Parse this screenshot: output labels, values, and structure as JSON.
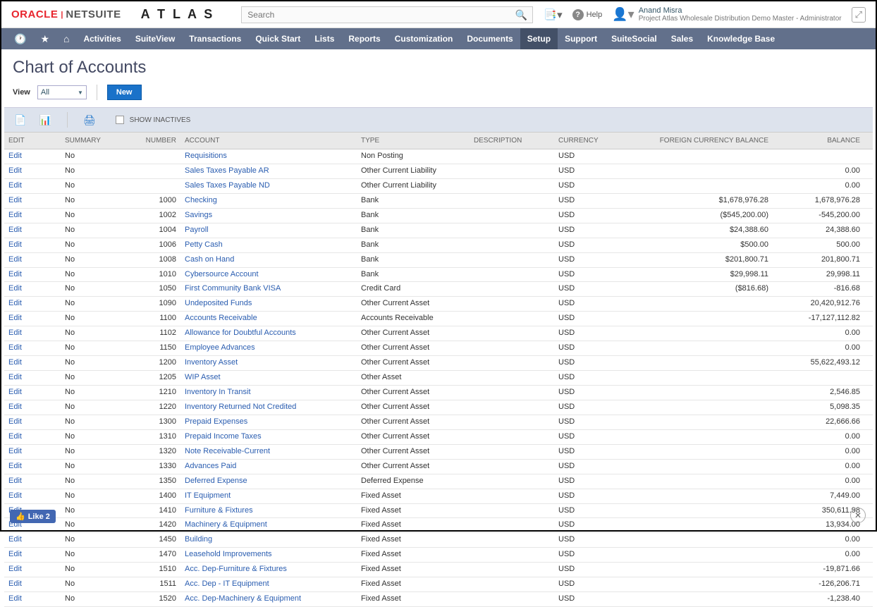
{
  "header": {
    "brand_oracle": "ORACLE",
    "brand_netsuite": "NETSUITE",
    "brand_atlas": "A T L A S",
    "search_placeholder": "Search",
    "help_label": "Help",
    "user_name": "Anand Misra",
    "user_role": "Project Atlas Wholesale Distribution Demo Master - Administrator"
  },
  "nav": {
    "items": [
      "Activities",
      "SuiteView",
      "Transactions",
      "Quick Start",
      "Lists",
      "Reports",
      "Customization",
      "Documents",
      "Setup",
      "Support",
      "SuiteSocial",
      "Sales",
      "Knowledge Base"
    ],
    "active_index": 8
  },
  "page": {
    "title": "Chart of Accounts",
    "view_label": "View",
    "view_value": "All",
    "new_button": "New",
    "show_inactives": "SHOW INACTIVES"
  },
  "columns": {
    "edit": "EDIT",
    "summary": "SUMMARY",
    "number": "NUMBER",
    "account": "ACCOUNT",
    "type": "TYPE",
    "description": "DESCRIPTION",
    "currency": "CURRENCY",
    "fcb": "FOREIGN CURRENCY BALANCE",
    "balance": "BALANCE"
  },
  "rows": [
    {
      "edit": "Edit",
      "summary": "No",
      "number": "",
      "account": "Requisitions",
      "type": "Non Posting",
      "desc": "",
      "currency": "USD",
      "fcb": "",
      "bal": ""
    },
    {
      "edit": "Edit",
      "summary": "No",
      "number": "",
      "account": "Sales Taxes Payable AR",
      "type": "Other Current Liability",
      "desc": "",
      "currency": "USD",
      "fcb": "",
      "bal": "0.00"
    },
    {
      "edit": "Edit",
      "summary": "No",
      "number": "",
      "account": "Sales Taxes Payable ND",
      "type": "Other Current Liability",
      "desc": "",
      "currency": "USD",
      "fcb": "",
      "bal": "0.00"
    },
    {
      "edit": "Edit",
      "summary": "No",
      "number": "1000",
      "account": "Checking",
      "type": "Bank",
      "desc": "",
      "currency": "USD",
      "fcb": "$1,678,976.28",
      "bal": "1,678,976.28"
    },
    {
      "edit": "Edit",
      "summary": "No",
      "number": "1002",
      "account": "Savings",
      "type": "Bank",
      "desc": "",
      "currency": "USD",
      "fcb": "($545,200.00)",
      "bal": "-545,200.00"
    },
    {
      "edit": "Edit",
      "summary": "No",
      "number": "1004",
      "account": "Payroll",
      "type": "Bank",
      "desc": "",
      "currency": "USD",
      "fcb": "$24,388.60",
      "bal": "24,388.60"
    },
    {
      "edit": "Edit",
      "summary": "No",
      "number": "1006",
      "account": "Petty Cash",
      "type": "Bank",
      "desc": "",
      "currency": "USD",
      "fcb": "$500.00",
      "bal": "500.00"
    },
    {
      "edit": "Edit",
      "summary": "No",
      "number": "1008",
      "account": "Cash on Hand",
      "type": "Bank",
      "desc": "",
      "currency": "USD",
      "fcb": "$201,800.71",
      "bal": "201,800.71"
    },
    {
      "edit": "Edit",
      "summary": "No",
      "number": "1010",
      "account": "Cybersource Account",
      "type": "Bank",
      "desc": "",
      "currency": "USD",
      "fcb": "$29,998.11",
      "bal": "29,998.11"
    },
    {
      "edit": "Edit",
      "summary": "No",
      "number": "1050",
      "account": "First Community Bank VISA",
      "type": "Credit Card",
      "desc": "",
      "currency": "USD",
      "fcb": "($816.68)",
      "bal": "-816.68"
    },
    {
      "edit": "Edit",
      "summary": "No",
      "number": "1090",
      "account": "Undeposited Funds",
      "type": "Other Current Asset",
      "desc": "",
      "currency": "USD",
      "fcb": "",
      "bal": "20,420,912.76"
    },
    {
      "edit": "Edit",
      "summary": "No",
      "number": "1100",
      "account": "Accounts Receivable",
      "type": "Accounts Receivable",
      "desc": "",
      "currency": "USD",
      "fcb": "",
      "bal": "-17,127,112.82"
    },
    {
      "edit": "Edit",
      "summary": "No",
      "number": "1102",
      "account": "Allowance for Doubtful Accounts",
      "type": "Other Current Asset",
      "desc": "",
      "currency": "USD",
      "fcb": "",
      "bal": "0.00"
    },
    {
      "edit": "Edit",
      "summary": "No",
      "number": "1150",
      "account": "Employee Advances",
      "type": "Other Current Asset",
      "desc": "",
      "currency": "USD",
      "fcb": "",
      "bal": "0.00"
    },
    {
      "edit": "Edit",
      "summary": "No",
      "number": "1200",
      "account": "Inventory Asset",
      "type": "Other Current Asset",
      "desc": "",
      "currency": "USD",
      "fcb": "",
      "bal": "55,622,493.12"
    },
    {
      "edit": "Edit",
      "summary": "No",
      "number": "1205",
      "account": "WIP Asset",
      "type": "Other Asset",
      "desc": "",
      "currency": "USD",
      "fcb": "",
      "bal": ""
    },
    {
      "edit": "Edit",
      "summary": "No",
      "number": "1210",
      "account": "Inventory In Transit",
      "type": "Other Current Asset",
      "desc": "",
      "currency": "USD",
      "fcb": "",
      "bal": "2,546.85"
    },
    {
      "edit": "Edit",
      "summary": "No",
      "number": "1220",
      "account": "Inventory Returned Not Credited",
      "type": "Other Current Asset",
      "desc": "",
      "currency": "USD",
      "fcb": "",
      "bal": "5,098.35"
    },
    {
      "edit": "Edit",
      "summary": "No",
      "number": "1300",
      "account": "Prepaid Expenses",
      "type": "Other Current Asset",
      "desc": "",
      "currency": "USD",
      "fcb": "",
      "bal": "22,666.66"
    },
    {
      "edit": "Edit",
      "summary": "No",
      "number": "1310",
      "account": "Prepaid Income Taxes",
      "type": "Other Current Asset",
      "desc": "",
      "currency": "USD",
      "fcb": "",
      "bal": "0.00"
    },
    {
      "edit": "Edit",
      "summary": "No",
      "number": "1320",
      "account": "Note Receivable-Current",
      "type": "Other Current Asset",
      "desc": "",
      "currency": "USD",
      "fcb": "",
      "bal": "0.00"
    },
    {
      "edit": "Edit",
      "summary": "No",
      "number": "1330",
      "account": "Advances Paid",
      "type": "Other Current Asset",
      "desc": "",
      "currency": "USD",
      "fcb": "",
      "bal": "0.00"
    },
    {
      "edit": "Edit",
      "summary": "No",
      "number": "1350",
      "account": "Deferred Expense",
      "type": "Deferred Expense",
      "desc": "",
      "currency": "USD",
      "fcb": "",
      "bal": "0.00"
    },
    {
      "edit": "Edit",
      "summary": "No",
      "number": "1400",
      "account": "IT Equipment",
      "type": "Fixed Asset",
      "desc": "",
      "currency": "USD",
      "fcb": "",
      "bal": "7,449.00"
    },
    {
      "edit": "Edit",
      "summary": "No",
      "number": "1410",
      "account": "Furniture & Fixtures",
      "type": "Fixed Asset",
      "desc": "",
      "currency": "USD",
      "fcb": "",
      "bal": "350,611.98"
    },
    {
      "edit": "Edit",
      "summary": "No",
      "number": "1420",
      "account": "Machinery & Equipment",
      "type": "Fixed Asset",
      "desc": "",
      "currency": "USD",
      "fcb": "",
      "bal": "13,934.00"
    },
    {
      "edit": "Edit",
      "summary": "No",
      "number": "1450",
      "account": "Building",
      "type": "Fixed Asset",
      "desc": "",
      "currency": "USD",
      "fcb": "",
      "bal": "0.00"
    },
    {
      "edit": "Edit",
      "summary": "No",
      "number": "1470",
      "account": "Leasehold Improvements",
      "type": "Fixed Asset",
      "desc": "",
      "currency": "USD",
      "fcb": "",
      "bal": "0.00"
    },
    {
      "edit": "Edit",
      "summary": "No",
      "number": "1510",
      "account": "Acc. Dep-Furniture & Fixtures",
      "type": "Fixed Asset",
      "desc": "",
      "currency": "USD",
      "fcb": "",
      "bal": "-19,871.66"
    },
    {
      "edit": "Edit",
      "summary": "No",
      "number": "1511",
      "account": "Acc. Dep - IT Equipment",
      "type": "Fixed Asset",
      "desc": "",
      "currency": "USD",
      "fcb": "",
      "bal": "-126,206.71"
    },
    {
      "edit": "Edit",
      "summary": "No",
      "number": "1520",
      "account": "Acc. Dep-Machinery & Equipment",
      "type": "Fixed Asset",
      "desc": "",
      "currency": "USD",
      "fcb": "",
      "bal": "-1,238.40"
    }
  ],
  "fb_like": "Like 2"
}
